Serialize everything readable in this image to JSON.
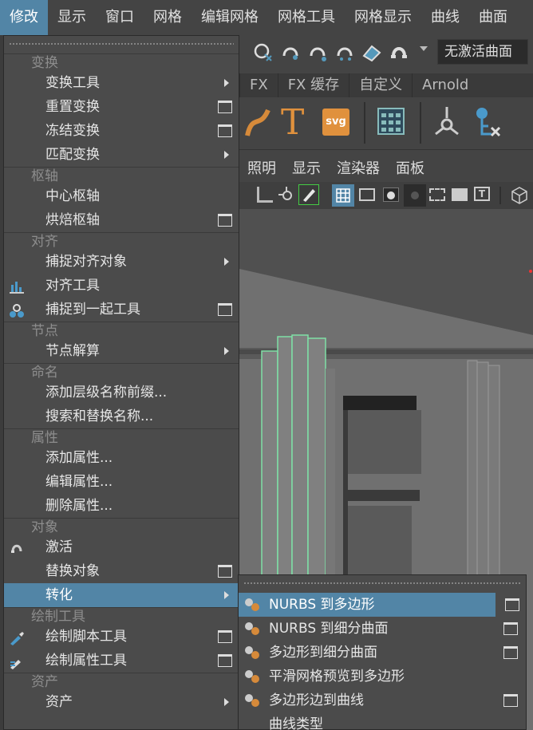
{
  "menubar": {
    "items": [
      "修改",
      "显示",
      "窗口",
      "网格",
      "编辑网格",
      "网格工具",
      "网格显示",
      "曲线",
      "曲面"
    ],
    "active_index": 0
  },
  "toolbar": {
    "inactive_field": "无激活曲面",
    "icons": [
      "snap-grid-icon",
      "snap-curve-icon",
      "snap-point-icon",
      "snap-view-icon",
      "snap-surface-icon",
      "snap-magnet-icon"
    ]
  },
  "shelf_tabs": [
    "FX",
    "FX 缓存",
    "自定义",
    "Arnold"
  ],
  "shelf": {
    "text_tool_label": "T",
    "svg_tool_label": "svg"
  },
  "panel_menu": [
    "照明",
    "显示",
    "渲染器",
    "面板"
  ],
  "main_menu": {
    "sections": [
      {
        "header": "变换",
        "items": [
          {
            "label": "变换工具",
            "suffix": "arrow"
          },
          {
            "label": "重置变换",
            "suffix": "option"
          },
          {
            "label": "冻结变换",
            "suffix": "option"
          },
          {
            "label": "匹配变换",
            "suffix": "arrow"
          }
        ]
      },
      {
        "header": "枢轴",
        "items": [
          {
            "label": "中心枢轴",
            "suffix": ""
          },
          {
            "label": "烘焙枢轴",
            "suffix": "option"
          }
        ]
      },
      {
        "header": "对齐",
        "items": [
          {
            "label": "捕捉对齐对象",
            "suffix": "arrow"
          },
          {
            "label": "对齐工具",
            "suffix": "",
            "icon": "align-tool-icon"
          },
          {
            "label": "捕捉到一起工具",
            "suffix": "option",
            "icon": "snap-together-icon"
          }
        ]
      },
      {
        "header": "节点",
        "items": [
          {
            "label": "节点解算",
            "suffix": "arrow"
          }
        ]
      },
      {
        "header": "命名",
        "items": [
          {
            "label": "添加层级名称前缀...",
            "suffix": ""
          },
          {
            "label": "搜索和替换名称...",
            "suffix": ""
          }
        ]
      },
      {
        "header": "属性",
        "items": [
          {
            "label": "添加属性...",
            "suffix": ""
          },
          {
            "label": "编辑属性...",
            "suffix": ""
          },
          {
            "label": "删除属性...",
            "suffix": ""
          }
        ]
      },
      {
        "header": "对象",
        "items": [
          {
            "label": "激活",
            "suffix": "",
            "icon": "magnet-icon"
          },
          {
            "label": "替换对象",
            "suffix": "option"
          },
          {
            "label": "转化",
            "suffix": "arrow",
            "active": true
          }
        ]
      },
      {
        "header": "绘制工具",
        "items": [
          {
            "label": "绘制脚本工具",
            "suffix": "option",
            "icon": "paint-script-icon"
          },
          {
            "label": "绘制属性工具",
            "suffix": "option",
            "icon": "paint-attribute-icon"
          }
        ]
      },
      {
        "header": "资产",
        "items": [
          {
            "label": "资产",
            "suffix": "arrow"
          }
        ]
      }
    ]
  },
  "sub_menu": {
    "items": [
      {
        "label": "NURBS 到多边形",
        "suffix": "option",
        "active": true
      },
      {
        "label": "NURBS 到细分曲面",
        "suffix": "option"
      },
      {
        "label": "多边形到细分曲面",
        "suffix": "option"
      },
      {
        "label": "平滑网格预览到多边形",
        "suffix": ""
      },
      {
        "label": "多边形边到曲线",
        "suffix": "option"
      },
      {
        "label": "曲线类型",
        "suffix": ""
      }
    ]
  }
}
